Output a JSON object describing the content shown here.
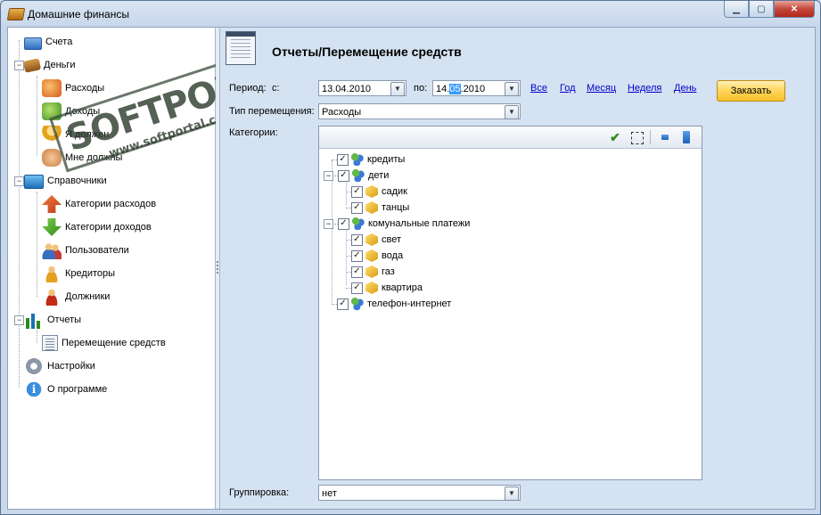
{
  "window": {
    "title": "Домашние финансы"
  },
  "tree": {
    "items": [
      {
        "label": "Счета",
        "icon": "card-icon"
      },
      {
        "label": "Деньги",
        "icon": "wallet-icon"
      },
      {
        "label": "Расходы",
        "icon": "money-out-icon"
      },
      {
        "label": "Доходы",
        "icon": "money-in-icon"
      },
      {
        "label": "Я должен",
        "icon": "i-owe-icon"
      },
      {
        "label": "Мне должны",
        "icon": "owed-to-me-icon"
      },
      {
        "label": "Справочники",
        "icon": "reference-book-icon"
      },
      {
        "label": "Категории расходов",
        "icon": "expense-categories-icon"
      },
      {
        "label": "Категории доходов",
        "icon": "income-categories-icon"
      },
      {
        "label": "Пользователи",
        "icon": "users-icon"
      },
      {
        "label": "Кредиторы",
        "icon": "creditors-icon"
      },
      {
        "label": "Должники",
        "icon": "debtors-icon"
      },
      {
        "label": "Отчеты",
        "icon": "chart-icon"
      },
      {
        "label": "Перемещение средств",
        "icon": "report-doc-icon"
      },
      {
        "label": "Настройки",
        "icon": "gear-icon"
      },
      {
        "label": "О программе",
        "icon": "info-icon"
      }
    ]
  },
  "header": {
    "title": "Отчеты/Перемещение средств"
  },
  "form": {
    "period_label": "Период:",
    "from_label": "с:",
    "from_date": "13.04.2010",
    "to_label": "по:",
    "to_date_pre": "14.",
    "to_date_sel": "05",
    "to_date_post": ".2010",
    "quick_links": [
      "Все",
      "Год",
      "Месяц",
      "Неделя",
      "День"
    ],
    "order_button": "Заказать",
    "movement_type_label": "Тип перемещения:",
    "movement_type_value": "Расходы",
    "categories_label": "Категории:",
    "grouping_label": "Группировка:",
    "grouping_value": "нет"
  },
  "categories": [
    {
      "label": "кредиты",
      "level": 0,
      "checked": true
    },
    {
      "label": "дети",
      "level": 0,
      "checked": true,
      "expanded": true
    },
    {
      "label": "садик",
      "level": 1,
      "checked": true
    },
    {
      "label": "танцы",
      "level": 1,
      "checked": true
    },
    {
      "label": "комунальные платежи",
      "level": 0,
      "checked": true,
      "expanded": true
    },
    {
      "label": "свет",
      "level": 1,
      "checked": true
    },
    {
      "label": "вода",
      "level": 1,
      "checked": true
    },
    {
      "label": "газ",
      "level": 1,
      "checked": true
    },
    {
      "label": "квартира",
      "level": 1,
      "checked": true
    },
    {
      "label": "телефон-интернет",
      "level": 0,
      "checked": true
    }
  ],
  "watermark": {
    "brand": "SOFTPORTAL",
    "url": "www.softportal.com"
  },
  "colors": {
    "link": "#0000cc",
    "order_button": "#ffd45a",
    "selection": "#3399ff"
  }
}
